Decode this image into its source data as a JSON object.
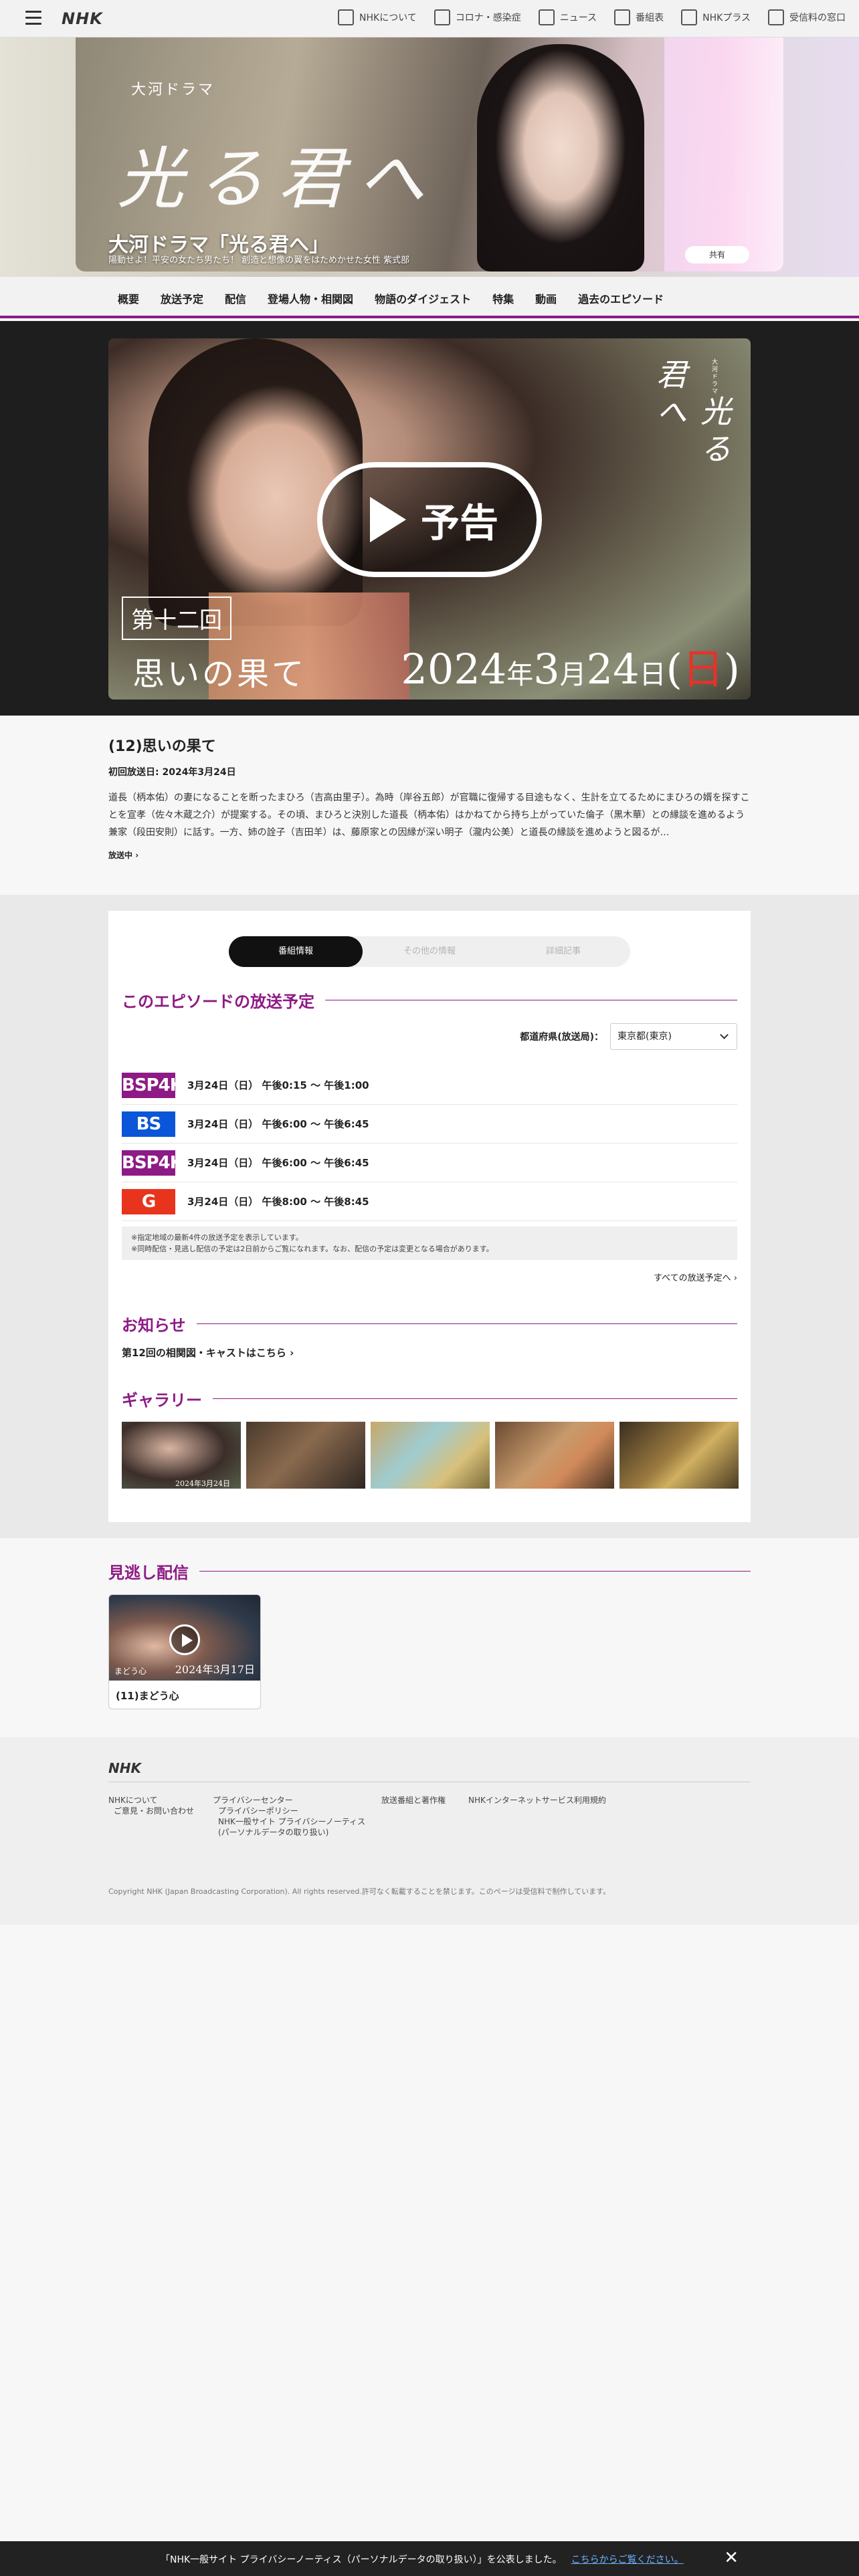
{
  "topbar": {
    "logo": "NHK",
    "links": [
      "NHKについて",
      "コロナ・感染症",
      "ニュース",
      "番組表",
      "NHKプラス",
      "受信料の窓口"
    ]
  },
  "hero": {
    "subtitle": "大河ドラマ",
    "logo_text": "光る君へ",
    "title": "大河ドラマ「光る君へ」",
    "tagline": "陽動せよ！平安の女たち男たち！ 創造と想像の翼をはためかせた女性 紫式部",
    "button": "共有"
  },
  "prognav": {
    "items": [
      "概要",
      "放送予定",
      "配信",
      "登場人物・相関図",
      "物語のダイジェスト",
      "特集",
      "動画",
      "過去のエピソード"
    ]
  },
  "video": {
    "logo_small": "大河ドラマ",
    "logo_text": "光る君へ",
    "play_label": "予告",
    "episode_no": "第十二回",
    "episode_name": "思いの果て",
    "date_year": "2024",
    "date_year_unit": "年",
    "date_month": "3",
    "date_month_unit": "月",
    "date_day": "24",
    "date_day_unit": "日",
    "date_open": "(",
    "date_weekday": "日",
    "date_close": ")"
  },
  "episode": {
    "title": "(12)思いの果て",
    "first_air": "初回放送日: 2024年3月24日",
    "synopsis": "道長（柄本佑）の妻になることを断ったまひろ（吉高由里子）。為時（岸谷五郎）が官職に復帰する目途もなく、生計を立てるためにまひろの婿を探すことを宣孝（佐々木蔵之介）が提案する。その頃、まひろと決別した道長（柄本佑）はかねてから持ち上がっていた倫子（黒木華）との縁談を進めるよう兼家（段田安則）に話す。一方、姉の詮子（吉田羊）は、藤原家との因縁が深い明子（瀧内公美）と道長の縁談を進めようと図るが…",
    "more": "放送中"
  },
  "tabs": [
    "番組情報",
    "その他の情報",
    "詳細記事"
  ],
  "schedule": {
    "heading": "このエピソードの放送予定",
    "pref_label": "都道府県(放送局)：",
    "pref_value": "東京都(東京)",
    "rows": [
      {
        "badge": "BSP4K",
        "color": "#8e1a85",
        "time": "3月24日（日） 午後0:15 〜 午後1:00"
      },
      {
        "badge": "BS",
        "color": "#0b55d8",
        "time": "3月24日（日） 午後6:00 〜 午後6:45"
      },
      {
        "badge": "BSP4K",
        "color": "#8e1a85",
        "time": "3月24日（日） 午後6:00 〜 午後6:45"
      },
      {
        "badge": "G",
        "color": "#e8341c",
        "time": "3月24日（日） 午後8:00 〜 午後8:45"
      }
    ],
    "note1": "※指定地域の最新4件の放送予定を表示しています。",
    "note2": "※同時配信・見逃し配信の予定は2日前からご覧になれます。なお、配信の予定は変更となる場合があります。",
    "all_link": "すべての放送予定へ"
  },
  "news": {
    "heading": "お知らせ",
    "link": "第12回の相関図・キャストはこちら"
  },
  "gallery": {
    "heading": "ギャラリー",
    "first_caption": "2024年3月24日"
  },
  "missed": {
    "heading": "見逃し配信",
    "card_title": "(11)まどう心",
    "card_thumb_title": "まどう心",
    "card_date": "2024年3月17日"
  },
  "footer": {
    "logo": "NHK",
    "col1": [
      "NHKについて",
      "ご意見・お問い合わせ"
    ],
    "col2": [
      "プライバシーセンター",
      "プライバシーポリシー",
      "NHK一般サイト プライバシーノーティス",
      "(パーソナルデータの取り扱い)"
    ],
    "col3": [
      "放送番組と著作権"
    ],
    "col4": [
      "NHKインターネットサービス利用規約"
    ],
    "copyright": "Copyright NHK (Japan Broadcasting Corporation). All rights reserved.許可なく転載することを禁じます。このページは受信料で制作しています。"
  },
  "cookie": {
    "message": "「NHK一般サイト プライバシーノーティス（パーソナルデータの取り扱い）」を公表しました。",
    "link": "こちらからご覧ください。"
  }
}
